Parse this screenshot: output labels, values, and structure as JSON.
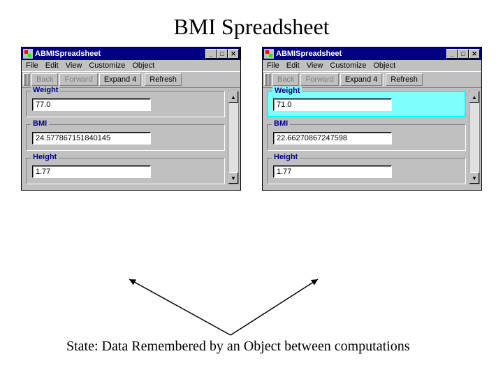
{
  "slide": {
    "title": "BMI Spreadsheet",
    "caption": "State: Data Remembered by an Object between computations"
  },
  "window_common": {
    "title": "ABMISpreadsheet",
    "menu": {
      "file": "File",
      "edit": "Edit",
      "view": "View",
      "customize": "Customize",
      "object": "Object"
    },
    "toolbar": {
      "back": "Back",
      "forward": "Forward",
      "expand": "Expand 4",
      "refresh": "Refresh"
    },
    "groups": {
      "weight_label": "Weight",
      "bmi_label": "BMI",
      "height_label": "Height"
    }
  },
  "left": {
    "weight": "77.0",
    "bmi": "24.577867151840145",
    "height": "1.77"
  },
  "right": {
    "weight": "71.0",
    "bmi": "22.66270867247598",
    "height": "1.77"
  }
}
